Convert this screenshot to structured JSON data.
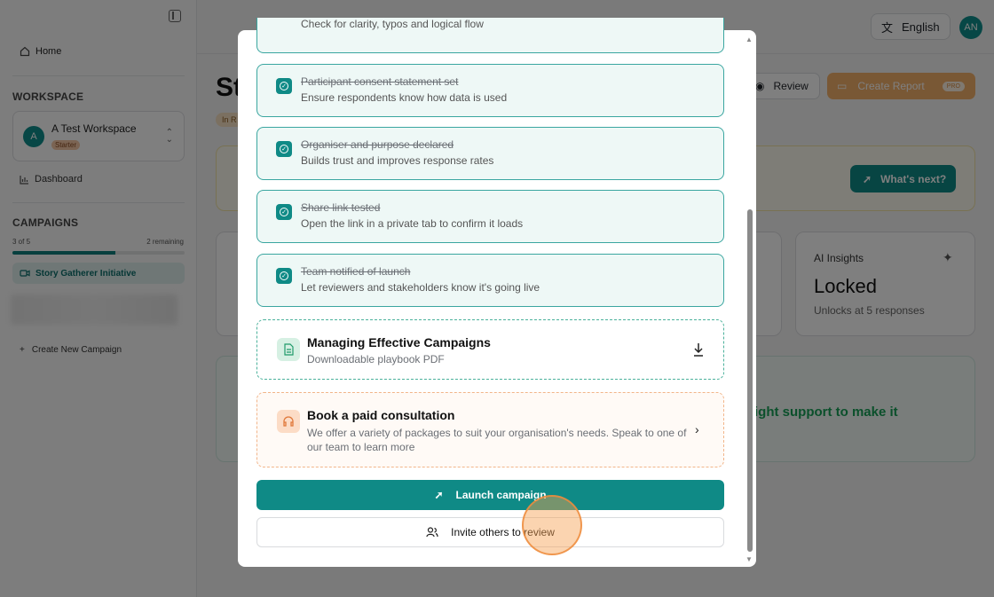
{
  "sidebar": {
    "home_label": "Home",
    "workspace_heading": "WORKSPACE",
    "workspace": {
      "initial": "A",
      "name": "A Test Workspace",
      "plan_badge": "Starter"
    },
    "dashboard_label": "Dashboard",
    "campaigns_heading": "CAMPAIGNS",
    "progress": {
      "left_text": "3 of 5",
      "right_text": "2 remaining",
      "fraction": 0.6
    },
    "active_campaign": "Story Gatherer Initiative",
    "create_campaign": "Create New Campaign"
  },
  "header": {
    "language": "English",
    "user_initials": "AN",
    "page_title": "St",
    "status_tag": "In R",
    "review_label": "Review",
    "create_report_label": "Create Report",
    "pro_badge": "PRO"
  },
  "banner": {
    "next_label": "What's next?"
  },
  "ai_insights": {
    "title": "AI Insights",
    "value": "Locked",
    "subtitle": "Unlocks at 5 responses"
  },
  "support": {
    "text": "ight support to make it"
  },
  "modal": {
    "partial_item_sub": "Check for clarity, typos and logical flow",
    "checklist": [
      {
        "title": "Participant consent statement set",
        "sub": "Ensure respondents know how data is used"
      },
      {
        "title": "Organiser and purpose declared",
        "sub": "Builds trust and improves response rates"
      },
      {
        "title": "Share link tested",
        "sub": "Open the link in a private tab to confirm it loads"
      },
      {
        "title": "Team notified of launch",
        "sub": "Let reviewers and stakeholders know it's going live"
      }
    ],
    "resource": {
      "title": "Managing Effective Campaigns",
      "sub": "Downloadable playbook PDF"
    },
    "consultation": {
      "title": "Book a paid consultation",
      "sub": "We offer a variety of packages to suit your organisation's needs. Speak to one of our team to learn more"
    },
    "launch_label": "Launch campaign",
    "invite_label": "Invite others to review"
  },
  "colors": {
    "teal": "#0f8a86",
    "orange": "#f3b06b"
  }
}
